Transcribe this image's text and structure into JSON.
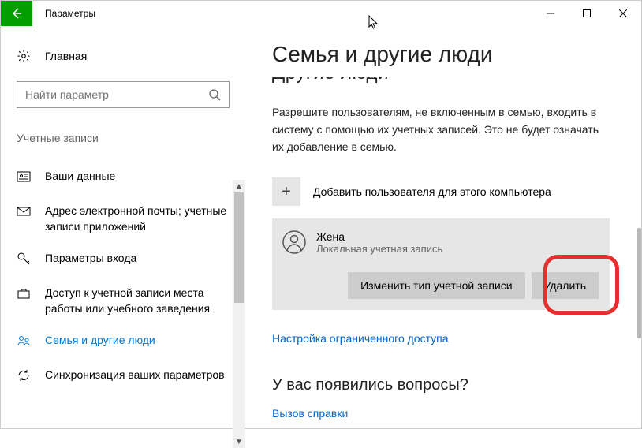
{
  "titlebar": {
    "title": "Параметры"
  },
  "sidebar": {
    "home": "Главная",
    "search_placeholder": "Найти параметр",
    "section": "Учетные записи",
    "items": [
      {
        "label": "Ваши данные"
      },
      {
        "label": "Адрес электронной почты; учетные записи приложений"
      },
      {
        "label": "Параметры входа"
      },
      {
        "label": "Доступ к учетной записи места работы или учебного заведения"
      },
      {
        "label": "Семья и другие люди"
      },
      {
        "label": "Синхронизация ваших параметров"
      }
    ]
  },
  "main": {
    "title": "Семья и другие люди",
    "clipped_subheading": "Другие люди",
    "description": "Разрешите пользователям, не включенным в семью, входить в систему с помощью их учетных записей. Это не будет означать их добавление в семью.",
    "add_user": "Добавить пользователя для этого компьютера",
    "user": {
      "name": "Жена",
      "type": "Локальная учетная запись",
      "change_btn": "Изменить тип учетной записи",
      "delete_btn": "Удалить"
    },
    "kiosk_link": "Настройка ограниченного доступа",
    "questions": "У вас появились вопросы?",
    "help": "Вызов справки"
  }
}
